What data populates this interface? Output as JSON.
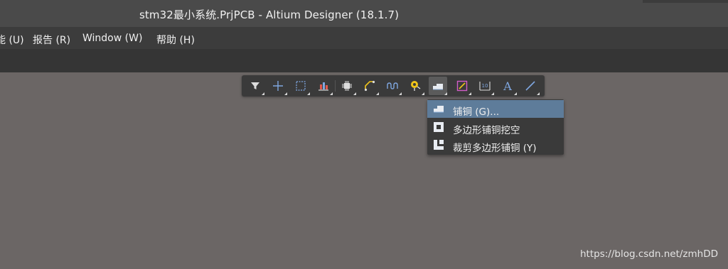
{
  "window": {
    "title": "stm32最小系统.PrjPCB - Altium Designer (18.1.7)"
  },
  "menubar": {
    "items": [
      {
        "label": "能 (U)"
      },
      {
        "label": "报告 (R)"
      },
      {
        "label": "Window (W)"
      },
      {
        "label": "帮助 (H)"
      }
    ]
  },
  "toolbar": {
    "buttons": [
      {
        "icon": "filter-icon"
      },
      {
        "icon": "crosshair-icon"
      },
      {
        "icon": "select-rectangle-icon"
      },
      {
        "icon": "align-icon"
      },
      {
        "icon": "component-icon"
      },
      {
        "icon": "interactive-route-icon"
      },
      {
        "icon": "differential-pair-icon"
      },
      {
        "icon": "via-icon"
      },
      {
        "icon": "polygon-pour-icon",
        "active": true
      },
      {
        "icon": "keepout-icon"
      },
      {
        "icon": "dimension-icon"
      },
      {
        "icon": "text-icon",
        "glyph": "A"
      },
      {
        "icon": "line-icon"
      }
    ]
  },
  "dropdown": {
    "items": [
      {
        "label": "铺铜 (G)...",
        "icon": "polygon-pour-icon",
        "highlighted": true
      },
      {
        "label": "多边形铺铜挖空",
        "icon": "polygon-cutout-icon",
        "highlighted": false
      },
      {
        "label": "裁剪多边形铺铜 (Y)",
        "icon": "slice-polygon-icon",
        "highlighted": false
      }
    ]
  },
  "watermark": {
    "text": "https://blog.csdn.net/zmhDD"
  },
  "colors": {
    "canvas": "#6b6665",
    "menu_highlight": "#5e7c9a",
    "icon_blue": "#7fa7e0",
    "icon_yellow": "#f0c419",
    "icon_pink": "#d25ec8"
  }
}
